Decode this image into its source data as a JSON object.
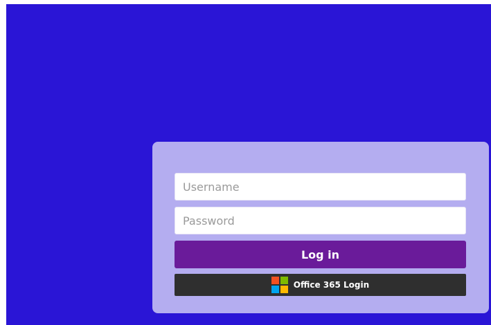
{
  "login_form": {
    "username_placeholder": "Username",
    "password_placeholder": "Password",
    "login_label": "Log in",
    "office365_label": "Office 365 Login"
  },
  "icons": {
    "microsoft_logo": "microsoft-logo-icon"
  },
  "colors": {
    "background": "#2a15d6",
    "card": "#b4adf0",
    "login_button": "#6a1b9a",
    "office_button": "#2f2f2f",
    "ms_red": "#f25022",
    "ms_green": "#7fba00",
    "ms_blue": "#00a4ef",
    "ms_yellow": "#ffb900"
  }
}
